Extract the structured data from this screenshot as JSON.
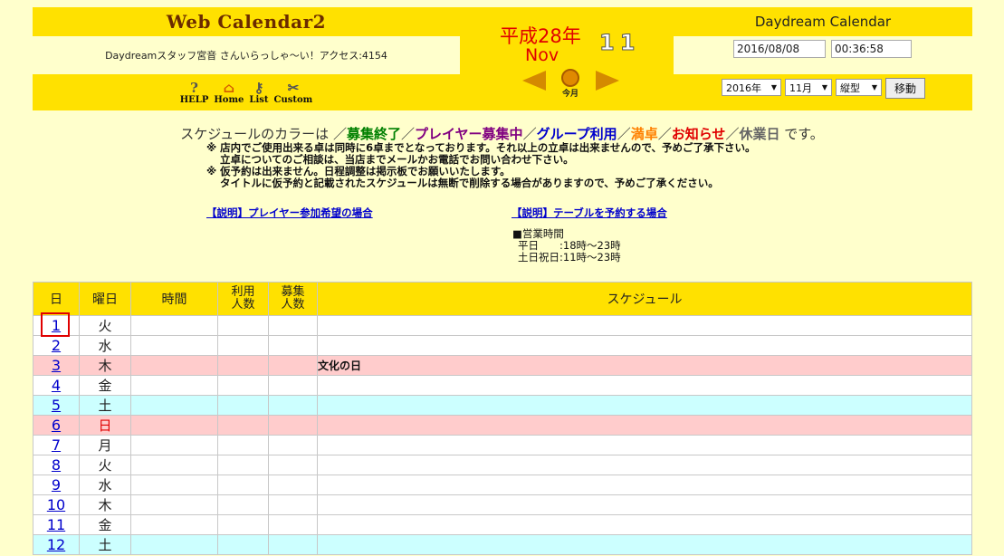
{
  "header": {
    "logo": "Web Calendar2",
    "greeting": "Daydreamスタッフ宮音 さんいらっしゃ〜い！アクセス:4154",
    "icons": [
      {
        "name": "help",
        "label": "HELP",
        "icon": "light-bulb-icon",
        "glyph": "💡"
      },
      {
        "name": "home",
        "label": "Home",
        "icon": "house-icon",
        "glyph": "⌂"
      },
      {
        "name": "list",
        "label": "List",
        "icon": "keys-icon",
        "glyph": "⚷"
      },
      {
        "name": "custom",
        "label": "Custom",
        "icon": "tools-icon",
        "glyph": "✂"
      }
    ]
  },
  "center": {
    "jp_year": "平成28年",
    "month_en": "Nov",
    "month_num": "11",
    "today_label": "今月"
  },
  "right": {
    "title": "Daydream Calendar",
    "date_value": "2016/08/08",
    "time_value": "00:36:58",
    "year_select": "2016年",
    "month_select": "11月",
    "layout_select": "縦型",
    "move_button": "移動"
  },
  "legend": {
    "prefix": "スケジュールのカラーは ／",
    "item1": "募集終了",
    "sep1": "／",
    "item2": "プレイヤー募集中",
    "sep2": "／",
    "item3": "グループ利用",
    "sep3": "／",
    "item4": "満卓",
    "sep4": "／",
    "item5": "お知らせ",
    "sep5": "／",
    "item6": "休業日",
    "suffix": " です。",
    "colors": {
      "item1": "#008000",
      "item2": "#800080",
      "item3": "#0000cc",
      "item4": "#ff8000",
      "item5": "#e00000",
      "item6": "#666666"
    }
  },
  "notes": {
    "line1": "※ 店内でご使用出来る卓は同時に6卓までとなっております。それ以上の立卓は出来ませんので、予めご了承下さい。",
    "line2": "立卓についてのご相談は、当店までメールかお電話でお問い合わせ下さい。",
    "line3": "※ 仮予約は出来ません。日程調整は掲示板でお願いいたします。",
    "line4": "タイトルに仮予約と記載されたスケジュールは無断で削除する場合がありますので、予めご了承ください。"
  },
  "links": {
    "player": "【説明】プレイヤー参加希望の場合",
    "table": "【説明】テーブルを予約する場合"
  },
  "hours": {
    "title": "■営業時間",
    "weekday": "平日　　:18時〜23時",
    "weekend": "土日祝日:11時〜23時"
  },
  "table": {
    "headers": {
      "day": "日",
      "weekday": "曜日",
      "time": "時間",
      "usage1": "利用",
      "usage2": "人数",
      "recruit1": "募集",
      "recruit2": "人数",
      "schedule": "スケジュール"
    },
    "rows": [
      {
        "day": "1",
        "weekday": "火",
        "schedule": "",
        "style": "white",
        "red": false
      },
      {
        "day": "2",
        "weekday": "水",
        "schedule": "",
        "style": "white",
        "red": false
      },
      {
        "day": "3",
        "weekday": "木",
        "schedule": "文化の日",
        "style": "pink",
        "red": false
      },
      {
        "day": "4",
        "weekday": "金",
        "schedule": "",
        "style": "white",
        "red": false
      },
      {
        "day": "5",
        "weekday": "土",
        "schedule": "",
        "style": "cyan",
        "red": false
      },
      {
        "day": "6",
        "weekday": "日",
        "schedule": "",
        "style": "pink",
        "red": true
      },
      {
        "day": "7",
        "weekday": "月",
        "schedule": "",
        "style": "white",
        "red": false
      },
      {
        "day": "8",
        "weekday": "火",
        "schedule": "",
        "style": "white",
        "red": false
      },
      {
        "day": "9",
        "weekday": "水",
        "schedule": "",
        "style": "white",
        "red": false
      },
      {
        "day": "10",
        "weekday": "木",
        "schedule": "",
        "style": "white",
        "red": false
      },
      {
        "day": "11",
        "weekday": "金",
        "schedule": "",
        "style": "white",
        "red": false
      },
      {
        "day": "12",
        "weekday": "土",
        "schedule": "",
        "style": "cyan",
        "red": false
      }
    ]
  }
}
